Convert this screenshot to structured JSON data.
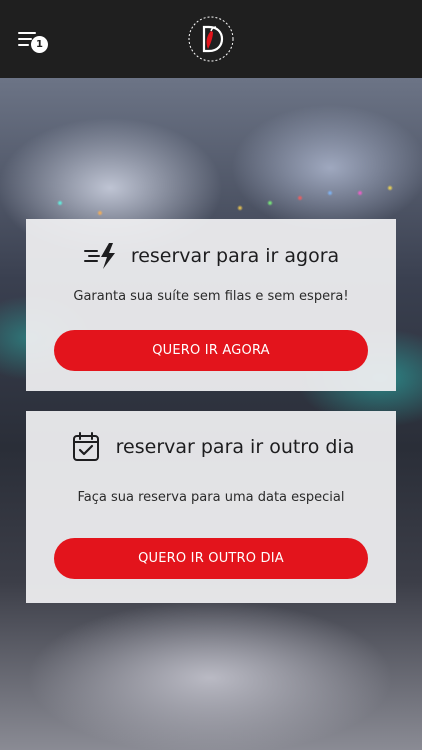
{
  "header": {
    "menu_icon": "menu-icon",
    "notification_count": "1",
    "logo_icon": "chili-pepper-logo"
  },
  "cards": [
    {
      "icon": "lightning-speed-icon",
      "title": "reservar para ir agora",
      "description": "Garanta sua suíte sem filas e sem espera!",
      "button_label": "QUERO IR AGORA"
    },
    {
      "icon": "calendar-check-icon",
      "title": "reservar para ir outro dia",
      "description": "Faça sua reserva para uma data especial",
      "button_label": "QUERO IR OUTRO DIA"
    }
  ],
  "colors": {
    "header_bg": "#1f1f1f",
    "accent": "#e3141c",
    "card_bg": "#eeeef0"
  }
}
